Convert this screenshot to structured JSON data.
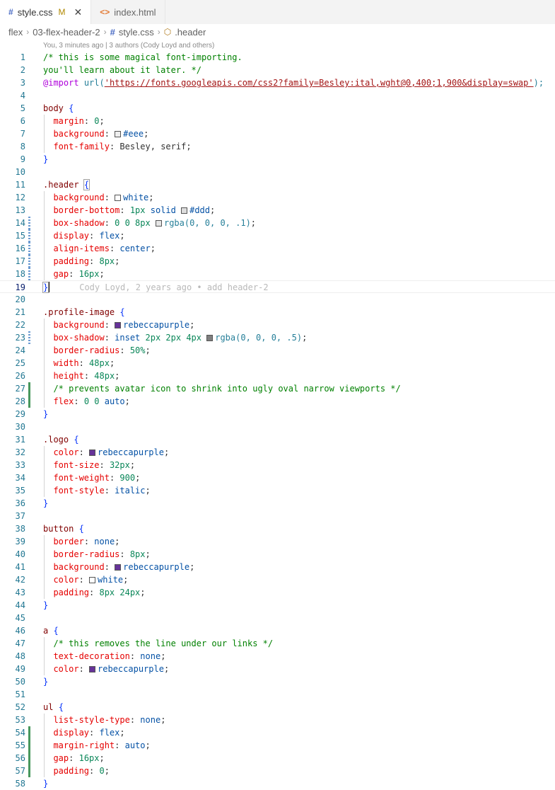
{
  "tabs": [
    {
      "label": "style.css",
      "modified": "M",
      "icon": "css-file-icon",
      "active": true
    },
    {
      "label": "index.html",
      "icon": "html-file-icon",
      "active": false
    }
  ],
  "breadcrumb": [
    "flex",
    "03-flex-header-2",
    "style.css",
    ".header"
  ],
  "blame_header": "You, 3 minutes ago | 3 authors (Cody Loyd and others)",
  "inline_blame": "Cody Loyd, 2 years ago • add header-2",
  "colors": {
    "eee": "#eeeeee",
    "white": "#ffffff",
    "ddd": "#dddddd",
    "shadow1": "rgba(0,0,0,0.1)",
    "shadow5": "rgba(0,0,0,0.5)",
    "purple": "#663399"
  },
  "code": {
    "l1": "/* this is some magical font-importing.",
    "l2": "you'll learn about it later. */",
    "l3_at": "@import",
    "l3_url": "url(",
    "l3_str": "'https://fonts.googleapis.com/css2?family=Besley:ital,wght@0,400;1,900&display=swap'",
    "l3_end": ");",
    "body": "body",
    "header": ".header",
    "profile": ".profile-image",
    "logo": ".logo",
    "button": "button",
    "a": "a",
    "ul": "ul",
    "open": "{",
    "close": "}",
    "margin": "margin",
    "background": "background",
    "font_family": "font-family",
    "border_bottom": "border-bottom",
    "box_shadow": "box-shadow",
    "display": "display",
    "align_items": "align-items",
    "padding": "padding",
    "gap": "gap",
    "border_radius": "border-radius",
    "width": "width",
    "height": "height",
    "flex": "flex",
    "color": "color",
    "font_size": "font-size",
    "font_weight": "font-weight",
    "font_style": "font-style",
    "border": "border",
    "text_decoration": "text-decoration",
    "list_style_type": "list-style-type",
    "margin_right": "margin-right",
    "v_0": "0",
    "v_eee": "#eee",
    "v_besley": "Besley, serif",
    "v_white": "white",
    "v_1px": "1px",
    "v_solid": "solid",
    "v_ddd": "#ddd",
    "v_shadow_nums": "0 0 8px",
    "v_rgba1": "rgba(0, 0, 0, .1)",
    "v_flex": "flex",
    "v_center": "center",
    "v_8px": "8px",
    "v_16px": "16px",
    "v_purple": "rebeccapurple",
    "v_inset": "inset",
    "v_inset_nums": "2px 2px 4px",
    "v_rgba5": "rgba(0, 0, 0, .5)",
    "v_50": "50%",
    "v_48": "48px",
    "comment_avatar": "/* prevents avatar icon to shrink into ugly oval narrow viewports */",
    "v_flex_nums": "0 0",
    "v_auto": "auto",
    "v_32": "32px",
    "v_900": "900",
    "v_italic": "italic",
    "v_none": "none",
    "v_pad_btn": "8px 24px",
    "comment_links": "/* this removes the line under our links */"
  },
  "line_numbers": [
    "1",
    "2",
    "3",
    "4",
    "5",
    "6",
    "7",
    "8",
    "9",
    "10",
    "11",
    "12",
    "13",
    "14",
    "15",
    "16",
    "17",
    "18",
    "19",
    "20",
    "21",
    "22",
    "23",
    "24",
    "25",
    "26",
    "27",
    "28",
    "29",
    "30",
    "31",
    "32",
    "33",
    "34",
    "35",
    "36",
    "37",
    "38",
    "39",
    "40",
    "41",
    "42",
    "43",
    "44",
    "45",
    "46",
    "47",
    "48",
    "49",
    "50",
    "51",
    "52",
    "53",
    "54",
    "55",
    "56",
    "57",
    "58"
  ]
}
